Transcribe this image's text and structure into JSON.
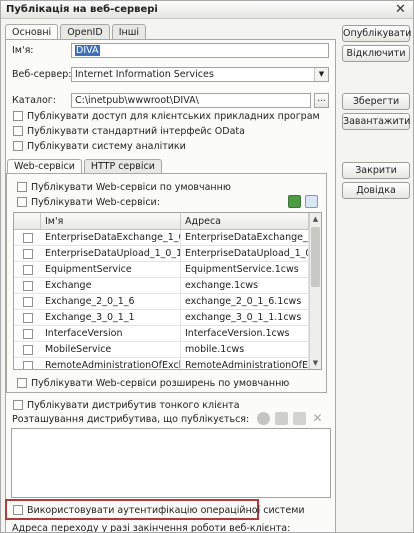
{
  "window": {
    "title": "Публікація на веб-сервері"
  },
  "tabs": [
    {
      "label": "Основні"
    },
    {
      "label": "OpenID"
    },
    {
      "label": "Інші"
    }
  ],
  "right_buttons": {
    "publish": "Опублікувати",
    "disable": "Відключити",
    "save": "Зберегти",
    "load": "Завантажити",
    "close": "Закрити",
    "help": "Довідка"
  },
  "form": {
    "name_label": "Ім'я:",
    "name_value": "DIVA",
    "webserver_label": "Веб-сервер:",
    "webserver_value": "Internet Information Services",
    "catalog_label": "Каталог:",
    "catalog_value": "C:\\inetpub\\wwwroot\\DIVA\\",
    "catalog_button": "..."
  },
  "options": [
    {
      "label": "Публікувати доступ для клієнтських прикладних програм"
    },
    {
      "label": "Публікувати стандартний інтерфейс OData"
    },
    {
      "label": "Публікувати систему аналітики"
    }
  ],
  "subtabs": [
    {
      "label": "Web-сервіси"
    },
    {
      "label": "HTTP сервіси"
    }
  ],
  "webservices": {
    "publish_default": "Публікувати Web-сервіси по умовчанню",
    "publish": "Публікувати Web-сервіси:",
    "columns": {
      "name": "Ім'я",
      "address": "Адреса"
    },
    "rows": [
      {
        "name": "EnterpriseDataExchange_1_0_1...",
        "address": "EnterpriseDataExchange_1..."
      },
      {
        "name": "EnterpriseDataUpload_1_0_1_1",
        "address": "EnterpriseDataUpload_1_0_1_..."
      },
      {
        "name": "EquipmentService",
        "address": "EquipmentService.1cws"
      },
      {
        "name": "Exchange",
        "address": "exchange.1cws"
      },
      {
        "name": "Exchange_2_0_1_6",
        "address": "exchange_2_0_1_6.1cws"
      },
      {
        "name": "Exchange_3_0_1_1",
        "address": "exchange_3_0_1_1.1cws"
      },
      {
        "name": "InterfaceVersion",
        "address": "InterfaceVersion.1cws"
      },
      {
        "name": "MobileService",
        "address": "mobile.1cws"
      },
      {
        "name": "RemoteAdministrationOfExchange",
        "address": "RemoteAdministrationOfExch..."
      }
    ],
    "extensions_default": "Публікувати Web-сервіси розширень по умовчанню"
  },
  "thin_client": {
    "publish": "Публікувати дистрибутив тонкого клієнта",
    "location_label": "Розташування дистрибутива, що публікується:"
  },
  "auth": {
    "label": "Використовувати аутентифікацію операційної системи"
  },
  "footer": {
    "redirect_label": "Адреса переходу у разі закінчення роботи веб-клієнта:"
  },
  "colors": {
    "accent": "#3d6fbf",
    "highlight_border": "#b23a3a"
  }
}
